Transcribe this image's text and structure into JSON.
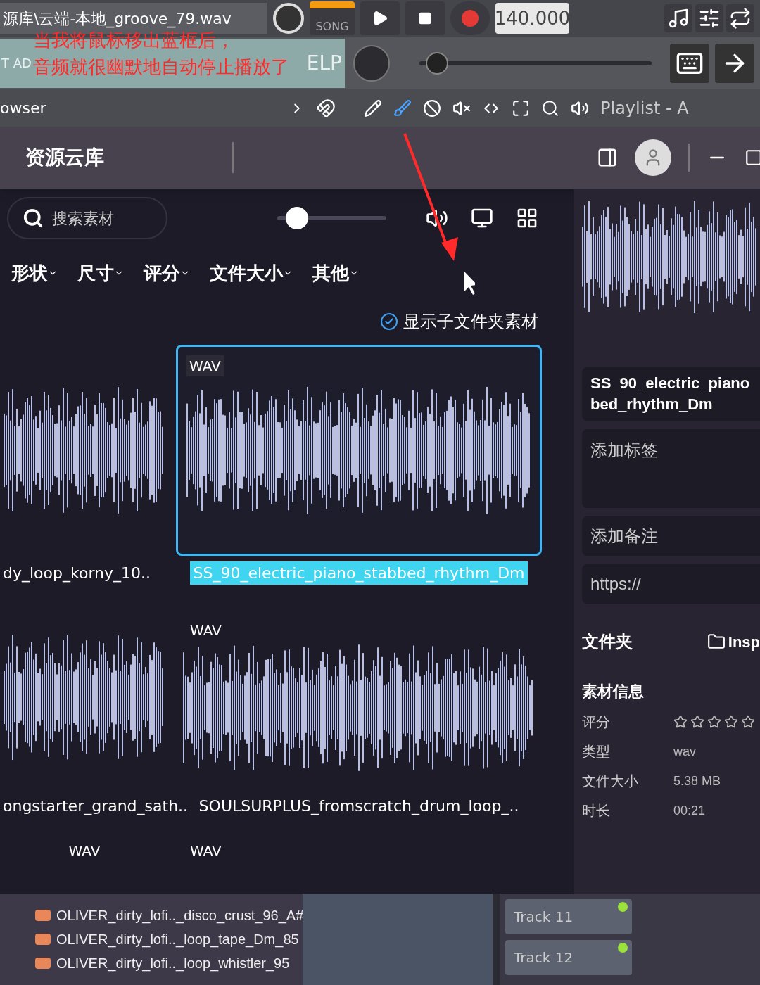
{
  "daw_top": {
    "file_hint": "源库\\云端-本地_groove_79.wav",
    "mode_label": "SONG",
    "tempo": "140.000",
    "hint_start": "T AD",
    "hint_end": "ELP",
    "master_slider": {
      "level": 0.03
    },
    "browser_label": "owser",
    "playlist_title": "Playlist - A"
  },
  "annotation": {
    "lines": [
      "当我将鼠标移出蓝框后，",
      "音频就很幽默地自动停止播放了"
    ]
  },
  "window": {
    "title": "资源云库"
  },
  "toolbar": {
    "search": {
      "placeholder": "搜索素材"
    },
    "zoom_slider": {
      "level": 0.1
    }
  },
  "filters": [
    {
      "label": "形状"
    },
    {
      "label": "尺寸"
    },
    {
      "label": "评分"
    },
    {
      "label": "文件大小"
    },
    {
      "label": "其他"
    }
  ],
  "subfolder_toggle": {
    "label": "显示子文件夹素材",
    "checked": true
  },
  "grid": {
    "rows": [
      [
        {
          "name": "dy_loop_korny_10..",
          "selected": false
        },
        {
          "name": "SS_90_electric_piano_stabbed_rhythm_Dm",
          "badge": "WAV",
          "selected": true
        }
      ],
      [
        {
          "name": "ongstarter_grand_sath..",
          "selected": false
        },
        {
          "name": "SOULSURPLUS_fromscratch_drum_loop_..",
          "badge": "WAV",
          "selected": false
        }
      ],
      [
        {
          "badge": "WAV",
          "selected": false
        },
        {
          "badge": "WAV",
          "selected": false
        }
      ]
    ]
  },
  "details": {
    "name_lines": [
      "SS_90_electric_piano",
      "bed_rhythm_Dm"
    ],
    "tags": {
      "placeholder": "添加标签"
    },
    "notes": {
      "placeholder": "添加备注"
    },
    "url": {
      "placeholder": "https://"
    },
    "folder": {
      "label": "文件夹",
      "button": "Insp"
    },
    "info_title": "素材信息",
    "info": [
      {
        "kind": "stars",
        "label": "评分",
        "stars": 0
      },
      {
        "kind": "text",
        "label": "类型",
        "value": "wav"
      },
      {
        "kind": "text",
        "label": "文件大小",
        "value": "5.38 MB"
      },
      {
        "kind": "text",
        "label": "时长",
        "value": "00:21"
      }
    ]
  },
  "browser": {
    "items": [
      {
        "label": "OLIVER_dirty_lofi.._disco_crust_96_A#"
      },
      {
        "label": "OLIVER_dirty_lofi.._loop_tape_Dm_85"
      },
      {
        "label": "OLIVER_dirty_lofi.._loop_whistler_95"
      }
    ]
  },
  "tracks": [
    {
      "label": "Track 11",
      "on": true
    },
    {
      "label": "Track 12",
      "on": true
    }
  ]
}
